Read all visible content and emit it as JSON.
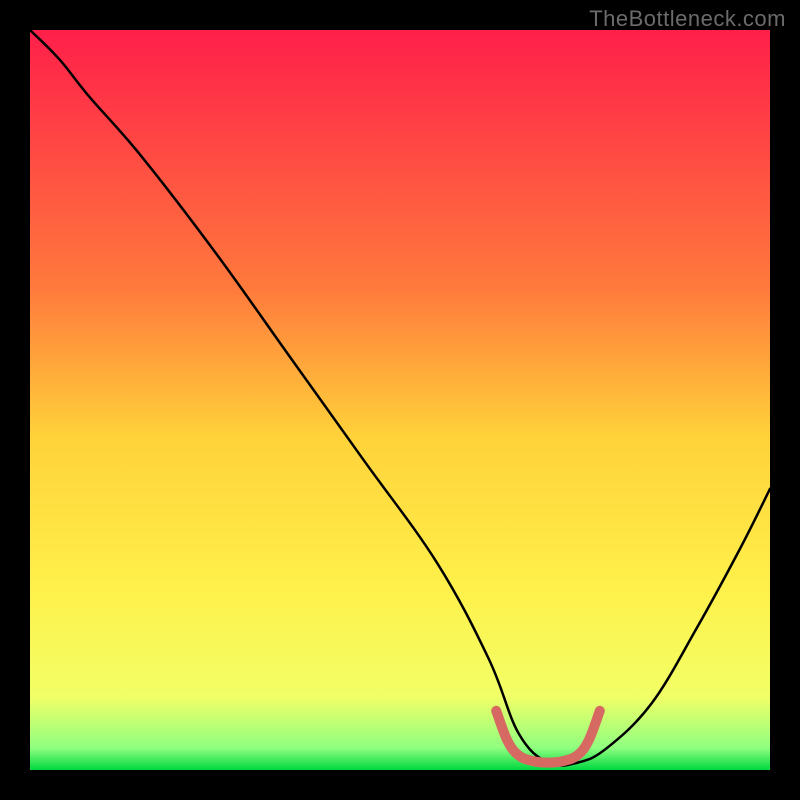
{
  "watermark": "TheBottleneck.com",
  "chart_data": {
    "type": "line",
    "title": "",
    "xlabel": "",
    "ylabel": "",
    "xlim": [
      0,
      100
    ],
    "ylim": [
      0,
      100
    ],
    "optimal_range_x": [
      64,
      76
    ],
    "background_gradient": {
      "stops": [
        {
          "offset": 0,
          "color": "#ff1f4a"
        },
        {
          "offset": 35,
          "color": "#ff7a3c"
        },
        {
          "offset": 55,
          "color": "#ffd23a"
        },
        {
          "offset": 75,
          "color": "#fff04a"
        },
        {
          "offset": 90,
          "color": "#f2ff66"
        },
        {
          "offset": 97,
          "color": "#90ff80"
        },
        {
          "offset": 100,
          "color": "#00d840"
        }
      ]
    },
    "series": [
      {
        "name": "bottleneck-curve",
        "color": "#000000",
        "width": 2.5,
        "x": [
          0,
          4,
          8,
          15,
          25,
          35,
          45,
          55,
          62,
          66,
          70,
          74,
          78,
          84,
          90,
          96,
          100
        ],
        "y": [
          100,
          96,
          91,
          83,
          70,
          56,
          42,
          28,
          15,
          5,
          1,
          1,
          3,
          9,
          19,
          30,
          38
        ]
      },
      {
        "name": "optimal-highlight",
        "color": "#d66a63",
        "width": 10,
        "x": [
          63,
          64.5,
          66,
          68,
          70,
          72,
          74,
          75.5,
          77
        ],
        "y": [
          8,
          4,
          2,
          1.2,
          1,
          1.2,
          2,
          4,
          8
        ]
      }
    ]
  }
}
